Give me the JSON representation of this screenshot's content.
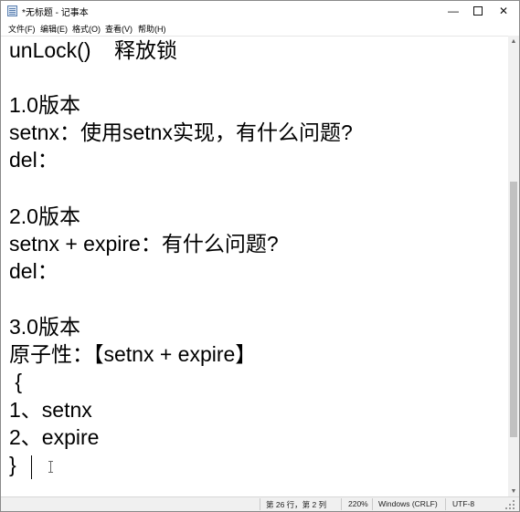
{
  "titlebar": {
    "title": "*无标题 - 记事本",
    "minimize_glyph": "—",
    "close_glyph": "✕"
  },
  "menu": {
    "items": [
      "文件(F)",
      "编辑(E)",
      "格式(O)",
      "查看(V)",
      "帮助(H)"
    ]
  },
  "editor": {
    "lines": [
      "unLock()    释放锁",
      "",
      "1.0版本",
      "setnx：使用setnx实现，有什么问题?",
      "del：",
      "",
      "2.0版本",
      "setnx + expire：有什么问题?",
      "del：",
      "",
      "3.0版本",
      "原子性：【setnx + expire】",
      " {",
      "1、setnx",
      "2、expire",
      "}"
    ]
  },
  "scrollbar": {
    "up_glyph": "▲",
    "down_glyph": "▼"
  },
  "status": {
    "position": "第 26 行，第 2 列",
    "zoom": "220%",
    "line_ending": "Windows (CRLF)",
    "encoding": "UTF-8"
  },
  "colors": {
    "chrome_bg": "#f0f0f0",
    "text": "#000000",
    "scroll_thumb": "#c1c1c1"
  }
}
